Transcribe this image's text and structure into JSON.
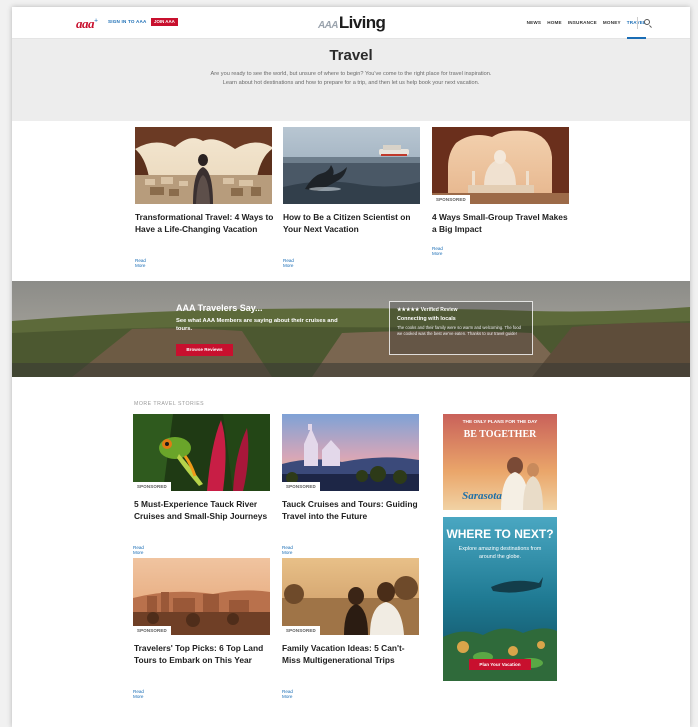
{
  "header": {
    "club_logo": "aaa",
    "club_logo_sup": "+",
    "login_text": "SIGN IN TO AAA",
    "join_label": "JOIN AAA",
    "site_logo_prefix": "AAA",
    "site_logo_main": "Living",
    "nav": [
      "NEWS",
      "HOME",
      "INSURANCE",
      "MONEY",
      "TRAVEL"
    ],
    "active_nav": "TRAVEL"
  },
  "hero": {
    "title": "Travel",
    "description": "Are you ready to see the world, but unsure of where to begin? You've come to the right place for travel inspiration. Learn about hot destinations and how to prepare for a trip, and then let us help book your next vacation."
  },
  "top_cards": [
    {
      "title": "Transformational Travel: 4 Ways to Have a Life-Changing Vacation",
      "read_more": "Read More",
      "tag": ""
    },
    {
      "title": "How to Be a Citizen Scientist on Your Next Vacation",
      "read_more": "Read More",
      "tag": ""
    },
    {
      "title": "4 Ways Small-Group Travel Makes a Big Impact",
      "read_more": "Read More",
      "tag": "SPONSORED"
    }
  ],
  "banner": {
    "title": "AAA Travelers Say...",
    "subtitle": "See what AAA Members are saying about their cruises and tours.",
    "button": "Browse Reviews",
    "review_stars": "★★★★★  Verified Review",
    "review_title": "Connecting with locals",
    "review_body": "The cooks and their family were so warm and welcoming. The food we cooked was the best we've eaten. Thanks to our travel guide!"
  },
  "section_label": "MORE TRAVEL STORIES",
  "more_cards": [
    {
      "title": "5 Must-Experience Tauck River Cruises and Small-Ship Journeys",
      "read_more": "Read More",
      "tag": "SPONSORED"
    },
    {
      "title": "Tauck Cruises and Tours: Guiding Travel into the Future",
      "read_more": "Read More",
      "tag": "SPONSORED"
    },
    {
      "title": "Travelers' Top Picks: 6 Top Land Tours to Embark on This Year",
      "read_more": "Read More",
      "tag": "SPONSORED"
    },
    {
      "title": "Family Vacation Ideas: 5 Can't-Miss Multigenerational Trips",
      "read_more": "Read More",
      "tag": "SPONSORED"
    }
  ],
  "ads": {
    "ad1_line1": "THE ONLY PLANS FOR THE DAY",
    "ad1_line2": "BE TOGETHER",
    "ad1_brand": "Sarasota",
    "ad2_title": "WHERE TO NEXT?",
    "ad2_body": "Explore amazing destinations from around the globe.",
    "ad2_button": "Plan Your Vacation"
  },
  "colors": {
    "accent_red": "#c8102e",
    "link_blue": "#1a6db5"
  }
}
